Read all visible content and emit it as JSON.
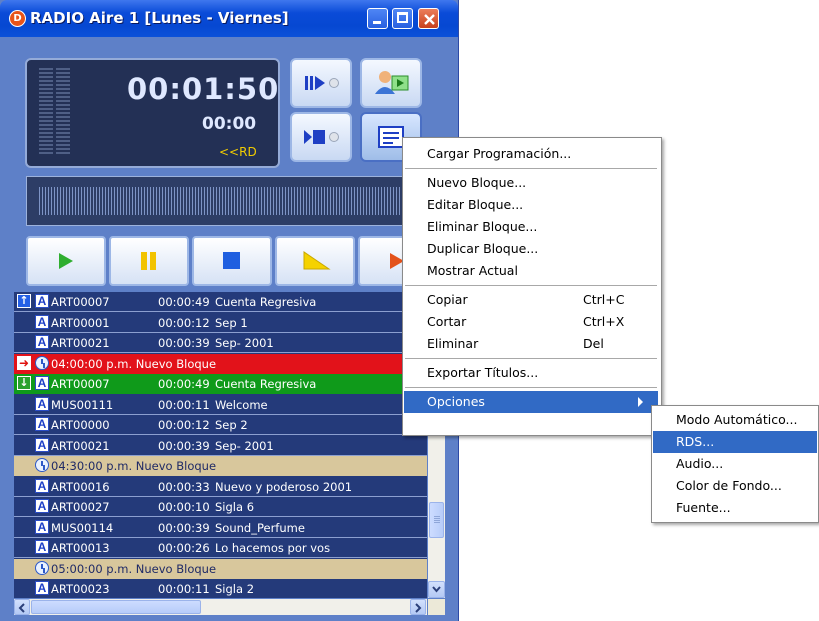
{
  "window": {
    "title": "RADIO Aire 1 [Lunes - Viernes]",
    "app_icon_letter": "D",
    "close_icon": "close-icon",
    "colors": {
      "titlebar": "#0648d2",
      "body": "#5e80c8",
      "display": "#233055",
      "accent_yellow": "#f2cc00"
    }
  },
  "player": {
    "time_main": "00:01:50",
    "time_sub": "00:00",
    "mode_label": "<<RD"
  },
  "playlist": {
    "rows": [
      {
        "type": "item",
        "style": "normal",
        "marker": "up",
        "code": "ART00007",
        "duration": "00:00:49",
        "title": "Cuenta Regresiva"
      },
      {
        "type": "item",
        "style": "normal",
        "marker": "",
        "code": "ART00001",
        "duration": "00:00:12",
        "title": "Sep 1"
      },
      {
        "type": "item",
        "style": "normal",
        "marker": "",
        "code": "ART00021",
        "duration": "00:00:39",
        "title": "Sep- 2001"
      },
      {
        "type": "block",
        "style": "red",
        "marker": "arrow",
        "block": "04:00:00 p.m. Nuevo Bloque"
      },
      {
        "type": "item",
        "style": "green",
        "marker": "down",
        "code": "ART00007",
        "duration": "00:00:49",
        "title": "Cuenta Regresiva"
      },
      {
        "type": "item",
        "style": "normal",
        "marker": "",
        "code": "MUS00111",
        "duration": "00:00:11",
        "title": "Welcome"
      },
      {
        "type": "item",
        "style": "normal",
        "marker": "",
        "code": "ART00000",
        "duration": "00:00:12",
        "title": "Sep 2"
      },
      {
        "type": "item",
        "style": "normal",
        "marker": "",
        "code": "ART00021",
        "duration": "00:00:39",
        "title": "Sep- 2001"
      },
      {
        "type": "block",
        "style": "tan",
        "marker": "",
        "block": "04:30:00 p.m. Nuevo Bloque"
      },
      {
        "type": "item",
        "style": "normal",
        "marker": "",
        "code": "ART00016",
        "duration": "00:00:33",
        "title": "Nuevo y poderoso 2001"
      },
      {
        "type": "item",
        "style": "normal",
        "marker": "",
        "code": "ART00027",
        "duration": "00:00:10",
        "title": "Sigla 6"
      },
      {
        "type": "item",
        "style": "normal",
        "marker": "",
        "code": "MUS00114",
        "duration": "00:00:39",
        "title": "Sound_Perfume"
      },
      {
        "type": "item",
        "style": "normal",
        "marker": "",
        "code": "ART00013",
        "duration": "00:00:26",
        "title": "Lo hacemos por vos"
      },
      {
        "type": "block",
        "style": "tan",
        "marker": "",
        "block": "05:00:00 p.m. Nuevo Bloque"
      },
      {
        "type": "item",
        "style": "normal",
        "marker": "",
        "code": "ART00023",
        "duration": "00:00:11",
        "title": "Sigla 2"
      }
    ]
  },
  "context_menu": {
    "items": [
      {
        "label": "Cargar Programación...",
        "shortcut": ""
      },
      {
        "separator": true
      },
      {
        "label": "Nuevo Bloque...",
        "shortcut": ""
      },
      {
        "label": "Editar Bloque...",
        "shortcut": ""
      },
      {
        "label": "Eliminar Bloque...",
        "shortcut": ""
      },
      {
        "label": "Duplicar Bloque...",
        "shortcut": ""
      },
      {
        "label": "Mostrar Actual",
        "shortcut": ""
      },
      {
        "separator": true
      },
      {
        "label": "Copiar",
        "shortcut": "Ctrl+C"
      },
      {
        "label": "Cortar",
        "shortcut": "Ctrl+X"
      },
      {
        "label": "Eliminar",
        "shortcut": "Del"
      },
      {
        "separator": true
      },
      {
        "label": "Exportar Títulos...",
        "shortcut": ""
      },
      {
        "separator": true
      },
      {
        "label": "Opciones",
        "shortcut": "",
        "submenu": true,
        "selected": true
      }
    ],
    "highlight_color": "#316ac5"
  },
  "submenu": {
    "items": [
      {
        "label": "Modo Automático...",
        "selected": false
      },
      {
        "label": "RDS...",
        "selected": true
      },
      {
        "label": "Audio...",
        "selected": false
      },
      {
        "label": "Color de Fondo...",
        "selected": false
      },
      {
        "label": "Fuente...",
        "selected": false
      }
    ]
  }
}
